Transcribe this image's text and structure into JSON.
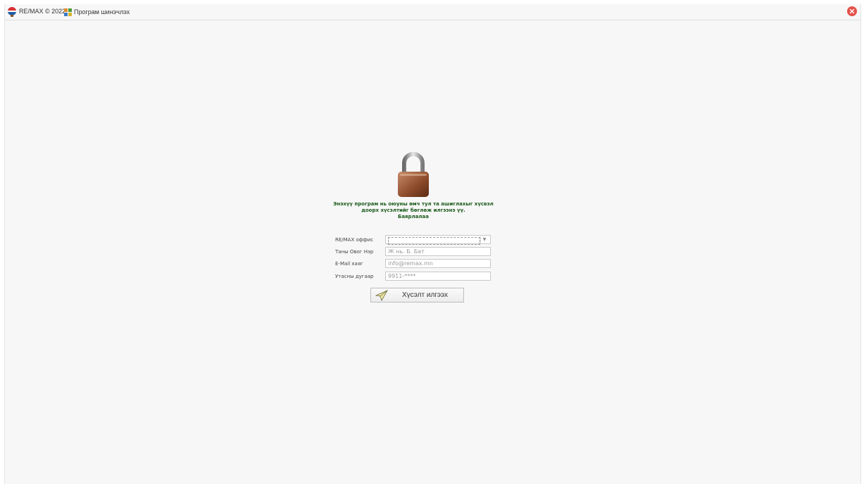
{
  "titlebar": {
    "app_title": "RE/MAX © 2022",
    "menu_item": "Програм шинэчлэх",
    "logo_icon": "remax-balloon-icon",
    "close_icon": "close-icon",
    "close_color": "#e3524a"
  },
  "main": {
    "lock_icon": "padlock-icon",
    "message_line1": "Энэхүү програм нь оюуны өмч тул та ашиглахыг хүсвэл",
    "message_line2": "доорх хүсэлтийг бөглөж илгээнэ үү.",
    "message_line3": "Баярлалаа",
    "message_color": "#1a5a1a"
  },
  "form": {
    "office_label": "RE/MAX оффис",
    "office_value": "",
    "name_label": "Таны Овог Нэр",
    "name_placeholder": "Ж нь. Б. Бат",
    "email_label": "E-Mail хаяг",
    "email_placeholder": "info@remax.mn",
    "phone_label": "Утасны дугаар",
    "phone_placeholder": "9911-****",
    "submit_label": "Хүсэлт илгээх",
    "submit_icon": "paper-plane-icon"
  }
}
